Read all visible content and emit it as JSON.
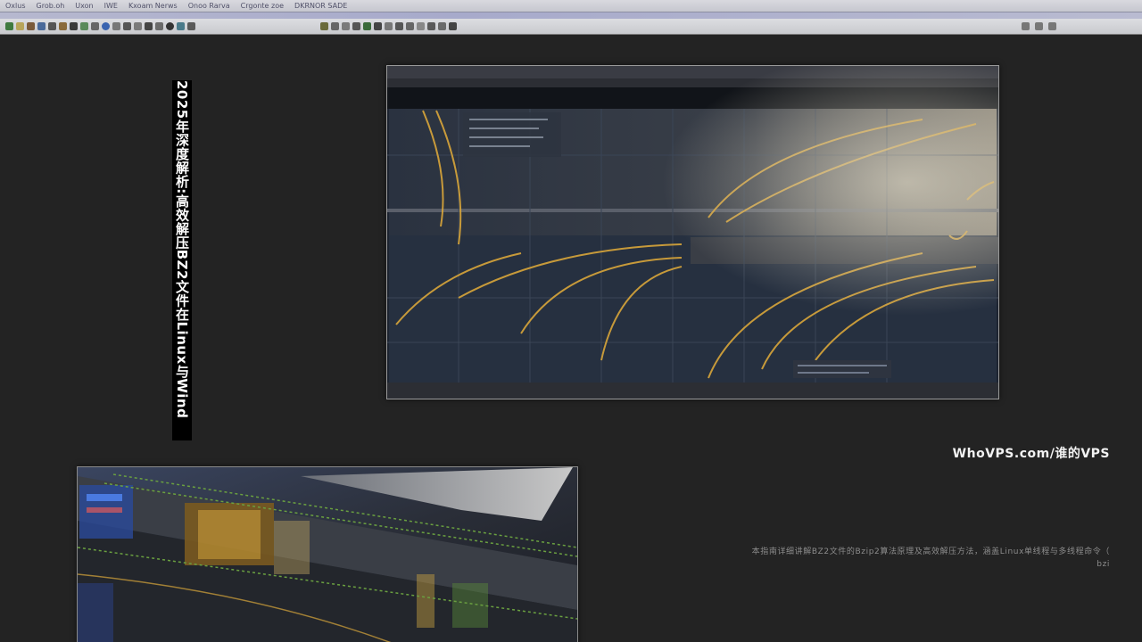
{
  "menubar": {
    "items": [
      "Oxlus",
      "Grob.oh",
      "Uxon",
      "IWE",
      "Kxoam Nerws",
      "Onoo Rarva",
      "Crgonte zoe",
      "DKRNOR SADE"
    ]
  },
  "title": {
    "vertical_text": "2025年深度解析:高效解压BZ2文件在Linux与Wind"
  },
  "site": {
    "label": "WhoVPS.com/谁的VPS"
  },
  "description": {
    "line1": "本指南详细讲解BZ2文件的Bzip2算法原理及高效解压方法，涵盖Linux单线程与多线程命令（",
    "line2": "bzi"
  },
  "figures": [
    {
      "name": "software-screenshot-waveform",
      "icon": "image"
    },
    {
      "name": "software-screenshot-stylized",
      "icon": "image"
    }
  ],
  "colors": {
    "background": "#232323",
    "gold_accent": "#d9a63a",
    "title_text": "#ffffff",
    "title_bg": "#000000"
  }
}
